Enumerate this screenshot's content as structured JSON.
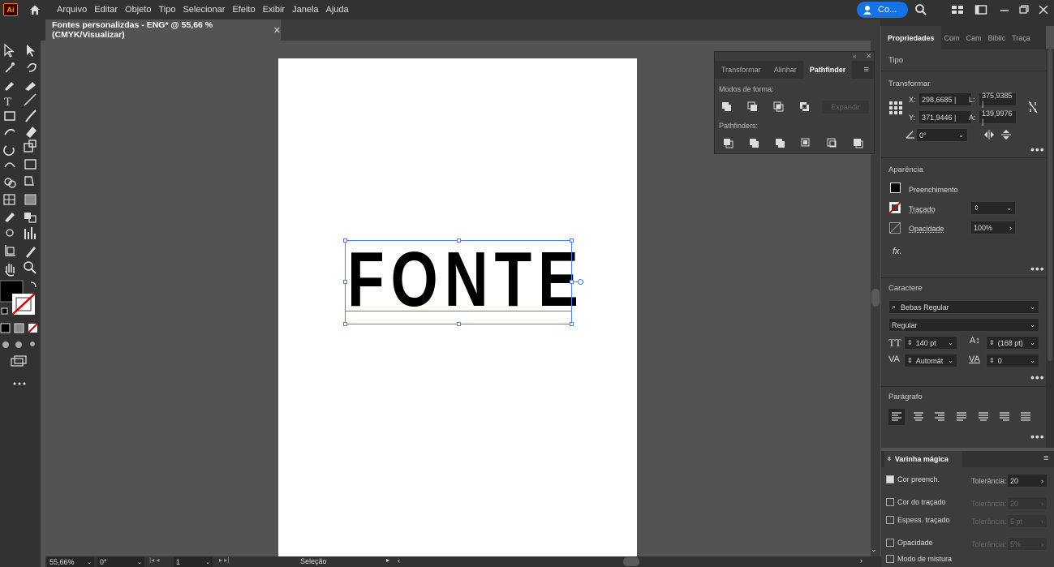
{
  "app": {
    "logo": "Ai",
    "menus": [
      "Arquivo",
      "Editar",
      "Objeto",
      "Tipo",
      "Selecionar",
      "Efeito",
      "Exibir",
      "Janela",
      "Ajuda"
    ],
    "collab_label": "Co..."
  },
  "document": {
    "tab_title": "Fontes personalizdas - ENG* @ 55,66 % (CMYK/Visualizar)",
    "close": "✕"
  },
  "canvas": {
    "text": "FONTE"
  },
  "pathfinder": {
    "tabs": [
      "Transformar",
      "Alinhar",
      "Pathfinder"
    ],
    "active_tab": "Pathfinder",
    "shape_modes_label": "Modos de forma:",
    "expand_label": "Expandir",
    "pathfinders_label": "Pathfinders:"
  },
  "properties": {
    "tabs": [
      "Propriedades",
      "Com",
      "Cam",
      "Biblic",
      "Traça"
    ],
    "section_type": "Tipo",
    "section_transform": "Transformar",
    "x_label": "X:",
    "x_value": "298,6685 |",
    "y_label": "Y:",
    "y_value": "371,9446 |",
    "w_label": "L:",
    "w_value": "375,9385 |",
    "h_label": "A:",
    "h_value": "139,9976 |",
    "angle_value": "0°",
    "section_appearance": "Aparência",
    "fill_label": "Preenchimento",
    "stroke_label": "Traçado",
    "opacity_label": "Opacidade",
    "opacity_value": "100%",
    "fx_label": "fx.",
    "section_character": "Caractere",
    "font_family": "Bebas Regular",
    "font_style": "Regular",
    "font_size": "140 pt",
    "leading": "(168 pt)",
    "kerning": "Automát",
    "tracking": "0",
    "section_paragraph": "Parágrafo",
    "more": "•••"
  },
  "magic_wand": {
    "title": "Varinha mágica",
    "rows": [
      {
        "label": "Cor preench.",
        "checked": true,
        "tol_label": "Tolerância:",
        "tol_value": "20"
      },
      {
        "label": "Cor do traçado",
        "checked": false,
        "tol_label": "Tolerância:",
        "tol_value": "20"
      },
      {
        "label": "Espess. traçado",
        "checked": false,
        "tol_label": "Tolerância:",
        "tol_value": "5 pt"
      },
      {
        "label": "Opacidade",
        "checked": false,
        "tol_label": "Tolerância:",
        "tol_value": "5%"
      },
      {
        "label": "Modo de mistura",
        "checked": false
      }
    ]
  },
  "status": {
    "zoom": "55,66%",
    "rotation": "0°",
    "artboard": "1",
    "mode": "Seleção"
  },
  "colors": {
    "accent": "#1473e6",
    "selection": "#4d7fff",
    "panel": "#3c3c3c",
    "dark": "#323232"
  }
}
